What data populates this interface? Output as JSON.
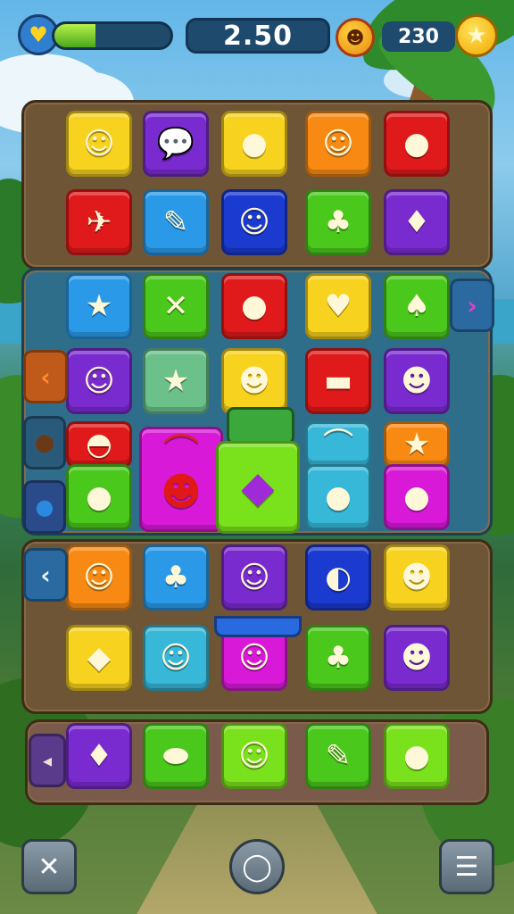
{
  "hud": {
    "score": "2.50",
    "coins": "230",
    "progress": 0.35,
    "life_icon": "heart-shield-icon",
    "avatar_icon": "face-token-icon",
    "coin_icon": "star-coin-icon"
  },
  "colors": {
    "yellow": "#f7d21e",
    "purple": "#7a2bd0",
    "pink": "#f0187a",
    "orange": "#f88a14",
    "red": "#e01a1a",
    "blue": "#2a9ae8",
    "navy": "#1a3ad0",
    "green": "#4ac81c",
    "magenta": "#d81ad8",
    "teal": "#38b8d8",
    "lime": "#7ae21c",
    "mint": "#6cc08a"
  },
  "tiles": [
    {
      "row": 0,
      "col": 0,
      "color": "yellow",
      "icon": "smiley-face-icon",
      "glyph": "☺"
    },
    {
      "row": 0,
      "col": 1,
      "color": "purple",
      "icon": "speech-bubble-icon",
      "glyph": "💬"
    },
    {
      "row": 0,
      "col": 2,
      "color": "yellow",
      "icon": "pink-candy-icon",
      "glyph": "●"
    },
    {
      "row": 0,
      "col": 3,
      "color": "orange",
      "icon": "smiley-bubble-icon",
      "glyph": "☺"
    },
    {
      "row": 0,
      "col": 4,
      "color": "red",
      "icon": "pink-bubble-icon",
      "glyph": "●"
    },
    {
      "row": 1,
      "col": 0,
      "color": "red",
      "icon": "paper-plane-icon",
      "glyph": "✈"
    },
    {
      "row": 1,
      "col": 1,
      "color": "blue",
      "icon": "pencil-icon",
      "glyph": "✎"
    },
    {
      "row": 1,
      "col": 2,
      "color": "navy",
      "icon": "bear-face-icon",
      "glyph": "☺"
    },
    {
      "row": 1,
      "col": 3,
      "color": "green",
      "icon": "lollipop-icon",
      "glyph": "♣"
    },
    {
      "row": 1,
      "col": 4,
      "color": "purple",
      "icon": "ice-cream-icon",
      "glyph": "♦"
    },
    {
      "row": 2,
      "col": 0,
      "color": "blue",
      "icon": "star-icon",
      "glyph": "★"
    },
    {
      "row": 2,
      "col": 1,
      "color": "green",
      "icon": "cross-candy-icon",
      "glyph": "✕"
    },
    {
      "row": 2,
      "col": 2,
      "color": "red",
      "icon": "purple-drop-icon",
      "glyph": "●"
    },
    {
      "row": 2,
      "col": 3,
      "color": "yellow",
      "icon": "heart-candy-icon",
      "glyph": "♥"
    },
    {
      "row": 2,
      "col": 4,
      "color": "green",
      "icon": "mushroom-icon",
      "glyph": "♠"
    },
    {
      "row": 3,
      "col": 0,
      "color": "purple",
      "icon": "smiley-bubble-icon",
      "glyph": "☺"
    },
    {
      "row": 3,
      "col": 1,
      "color": "mint",
      "icon": "star-icon",
      "glyph": "★"
    },
    {
      "row": 3,
      "col": 2,
      "color": "yellow",
      "icon": "monster-icon",
      "glyph": "☻"
    },
    {
      "row": 3,
      "col": 3,
      "color": "red",
      "icon": "jelly-candy-icon",
      "glyph": "▬"
    },
    {
      "row": 3,
      "col": 4,
      "color": "purple",
      "icon": "ghost-icon",
      "glyph": "☻"
    },
    {
      "row": 4,
      "col": 0,
      "color": "red",
      "icon": "taco-icon",
      "glyph": "◓"
    },
    {
      "row": 4,
      "col": 3,
      "color": "teal",
      "icon": "rainbow-icon",
      "glyph": "⌒"
    },
    {
      "row": 4,
      "col": 4,
      "color": "orange",
      "icon": "star-icon",
      "glyph": "★"
    },
    {
      "row": 5,
      "col": 0,
      "color": "green",
      "icon": "balloon-icon",
      "glyph": "●"
    },
    {
      "row": 5,
      "col": 1,
      "color": "magenta",
      "icon": "red-monster-icon",
      "glyph": "☻"
    },
    {
      "row": 5,
      "col": 3,
      "color": "teal",
      "icon": "red-ball-icon",
      "glyph": "●"
    },
    {
      "row": 5,
      "col": 4,
      "color": "magenta",
      "icon": "candy-wrap-icon",
      "glyph": "●"
    },
    {
      "row": 6,
      "col": 0,
      "color": "orange",
      "icon": "smiley-bubble-icon",
      "glyph": "☺"
    },
    {
      "row": 6,
      "col": 1,
      "color": "blue",
      "icon": "lollipop-icon",
      "glyph": "♣"
    },
    {
      "row": 6,
      "col": 2,
      "color": "purple",
      "icon": "bear-face-icon",
      "glyph": "☺"
    },
    {
      "row": 6,
      "col": 3,
      "color": "navy",
      "icon": "watermelon-icon",
      "glyph": "◐"
    },
    {
      "row": 6,
      "col": 4,
      "color": "yellow",
      "icon": "purple-monster-icon",
      "glyph": "☻"
    },
    {
      "row": 7,
      "col": 0,
      "color": "yellow",
      "icon": "blue-gem-icon",
      "glyph": "◆"
    },
    {
      "row": 7,
      "col": 1,
      "color": "teal",
      "icon": "smiley-bubble-icon",
      "glyph": "☺"
    },
    {
      "row": 7,
      "col": 2,
      "color": "magenta",
      "icon": "bear-face-icon",
      "glyph": "☺"
    },
    {
      "row": 7,
      "col": 3,
      "color": "green",
      "icon": "lollipop-icon",
      "glyph": "♣"
    },
    {
      "row": 7,
      "col": 4,
      "color": "purple",
      "icon": "chick-icon",
      "glyph": "☻"
    },
    {
      "row": 8,
      "col": 0,
      "color": "purple",
      "icon": "ice-cream-icon",
      "glyph": "♦"
    },
    {
      "row": 8,
      "col": 1,
      "color": "green",
      "icon": "purple-candy-icon",
      "glyph": "⬬"
    },
    {
      "row": 8,
      "col": 2,
      "color": "lime",
      "icon": "smiley-bubble-icon",
      "glyph": "☺"
    },
    {
      "row": 8,
      "col": 3,
      "color": "green",
      "icon": "pencil-icon",
      "glyph": "✎"
    },
    {
      "row": 8,
      "col": 4,
      "color": "lime",
      "icon": "purple-bubble-icon",
      "glyph": "●"
    }
  ],
  "special_tiles": [
    {
      "id": "rainbow-pink",
      "color": "magenta",
      "icon": "rainbow-icon",
      "glyph": "⌒"
    },
    {
      "id": "center-green",
      "color": "lime",
      "icon": "purple-candy-icon",
      "glyph": "◆"
    }
  ],
  "side_arrows": {
    "right_row2": "›",
    "left_row3": "‹",
    "left_row6": "‹",
    "left_row8": "◂"
  },
  "bottom": {
    "left_icon": "exit-icon",
    "left_glyph": "✕",
    "center_icon": "chat-bubble-icon",
    "center_glyph": "◯",
    "right_icon": "menu-icon",
    "right_glyph": "☰"
  }
}
